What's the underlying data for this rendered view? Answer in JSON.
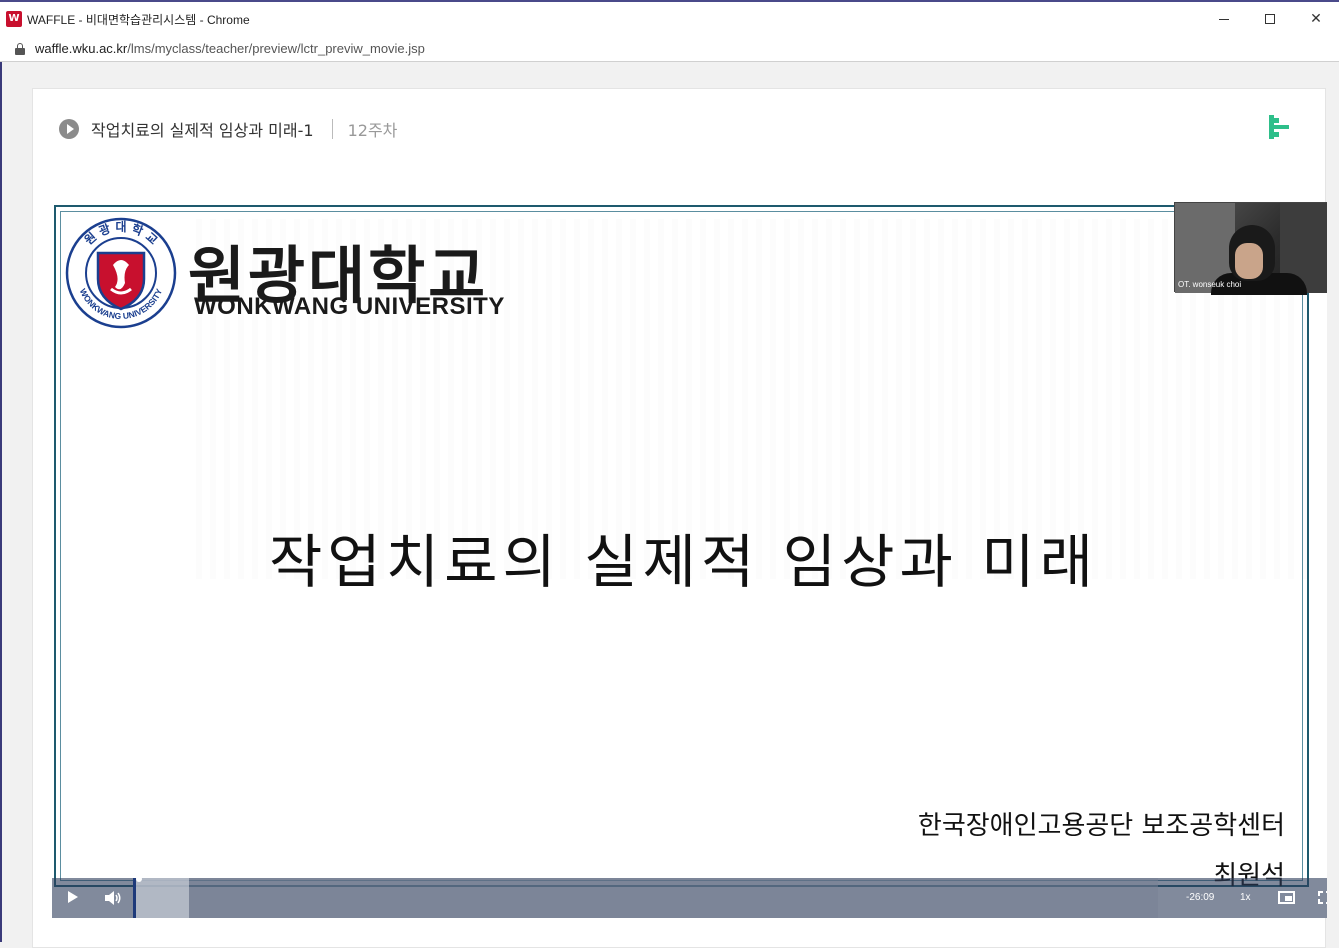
{
  "window": {
    "title": "WAFFLE - 비대면학습관리시스템 - Chrome",
    "controls": {
      "minimize": "—",
      "maximize": "☐",
      "close": "✕"
    }
  },
  "address": {
    "host": "waffle.wku.ac.kr",
    "path": "/lms/myclass/teacher/preview/lctr_previw_movie.jsp"
  },
  "lecture": {
    "title": "작업치료의 실제적 임상과 미래-1",
    "week": "12주차"
  },
  "slide": {
    "university_ko": "원광대학교",
    "university_en": "WONKWANG UNIVERSITY",
    "emblem_ring_top": "원 광 대 학 교",
    "emblem_ring_bottom": "WONKWANG UNIVERSITY",
    "title": "작업치료의 실제적 임상과 미래",
    "organization": "한국장애인고용공단 보조공학센터",
    "author": "최원석"
  },
  "webcam": {
    "name": "OT. wonseuk choi"
  },
  "player": {
    "time_remaining": "-26:09",
    "playback_rate": "1x",
    "buffered_fraction": 0.055,
    "played_fraction": 0.003
  },
  "colors": {
    "brand_green": "#2ebf8a",
    "slide_border": "#1e5a6e",
    "emblem_red": "#c8102e",
    "emblem_blue": "#1b3f8f"
  }
}
